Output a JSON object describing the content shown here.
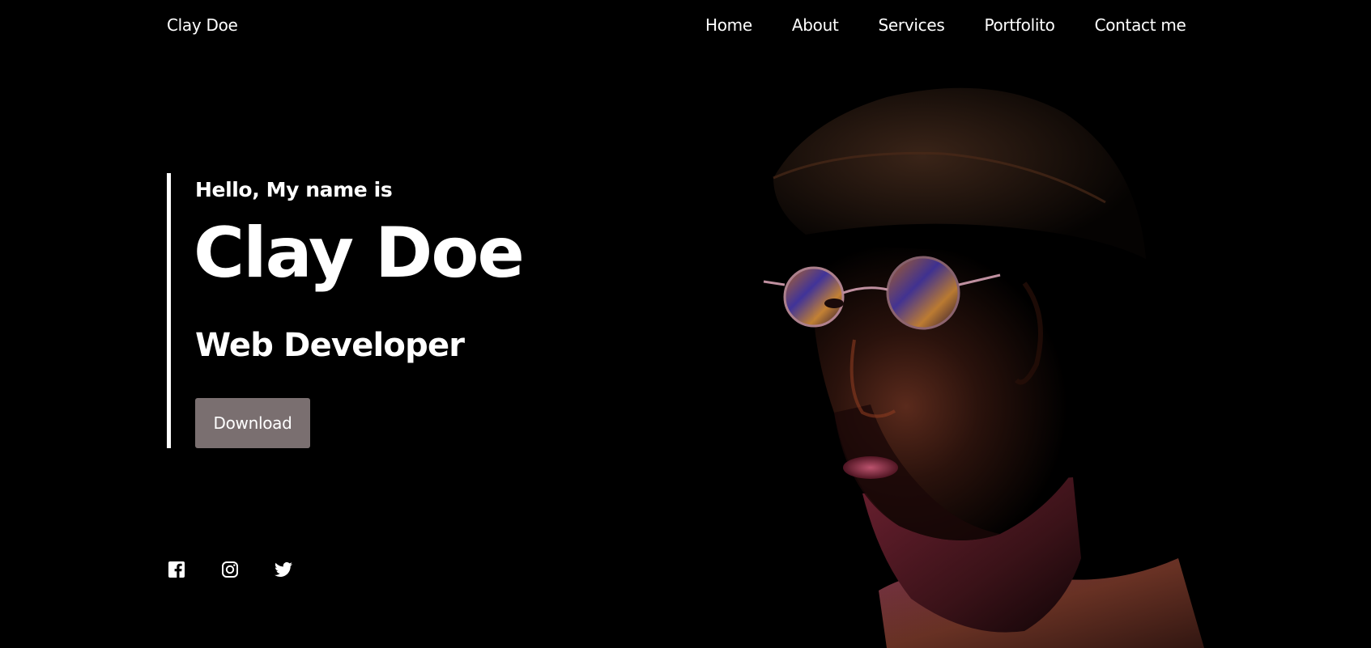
{
  "nav": {
    "brand": "Clay Doe",
    "items": [
      {
        "label": "Home"
      },
      {
        "label": "About"
      },
      {
        "label": "Services"
      },
      {
        "label": "Portfolito"
      },
      {
        "label": "Contact me"
      }
    ]
  },
  "hero": {
    "greeting": "Hello, My name is",
    "name": "Clay Doe",
    "role": "Web Developer",
    "download_label": "Download"
  },
  "social": [
    {
      "icon": "facebook-icon"
    },
    {
      "icon": "instagram-icon"
    },
    {
      "icon": "twitter-icon"
    }
  ],
  "colors": {
    "background": "#000000",
    "text": "#ffffff",
    "button": "#7a6f70"
  }
}
